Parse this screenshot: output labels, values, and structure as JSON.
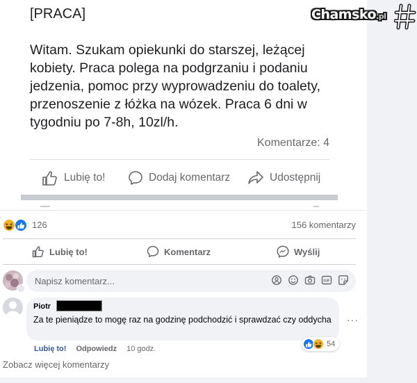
{
  "screenshot_post": {
    "tag": "[PRACA]",
    "text": "Witam. Szukam opiekunki do starszej, leżącej kobiety. Praca polega na podgrzaniu i podaniu jedzenia, pomoc przy wyprowadzeniu do toalety, przenoszenie z łóżka na wózek. Praca 6 dni w tygodniu po 7-8h, 10zl/h.",
    "comments_count": "Komentarze: 4",
    "actions": {
      "like": "Lubię to!",
      "comment": "Dodaj komentarz",
      "share": "Udostępnij"
    }
  },
  "watermark": {
    "brand": "Chamsko",
    "tld": ".pl"
  },
  "post_stats": {
    "reactions": "126",
    "comments": "156 komentarzy"
  },
  "actions": {
    "like": "Lubię to!",
    "comment": "Komentarz",
    "send": "Wyślij"
  },
  "composer": {
    "placeholder": "Napisz komentarz..."
  },
  "comment": {
    "author": "Piotr",
    "text": "Za te pieniądze to mogę raz na godzinę podchodzić i sprawdzać czy oddycha",
    "like": "Lubię to!",
    "reply": "Odpowiedz",
    "time": "10 godz.",
    "reactions": "54",
    "more": "···"
  },
  "see_more": "Zobacz więcej komentarzy",
  "colors": {
    "fb_blue": "#1877f2",
    "link_blue": "#385898",
    "haha_yellow": "#f7b125",
    "grey_text": "#65676b"
  },
  "icons": [
    "thumbs-up-icon",
    "speech-bubble-icon",
    "share-arrow-icon",
    "messenger-icon",
    "haha-emoji-icon",
    "like-emoji-icon",
    "sticker-icon",
    "emoji-icon",
    "camera-icon",
    "gif-icon",
    "more-icon"
  ]
}
